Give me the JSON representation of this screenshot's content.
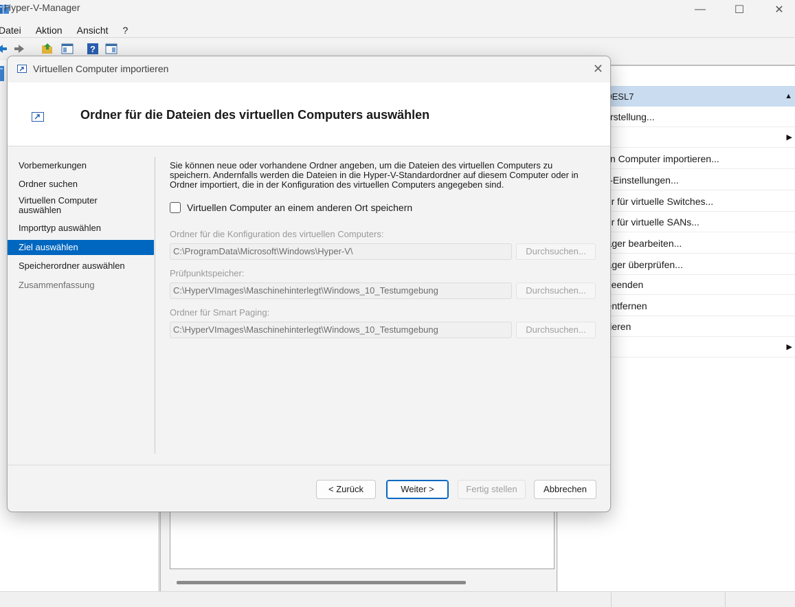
{
  "window": {
    "title": "Hyper-V-Manager",
    "minimize_glyph": "—",
    "maximize_glyph": "☐",
    "close_glyph": "✕"
  },
  "menu": [
    "Datei",
    "Aktion",
    "Ansicht",
    "?"
  ],
  "actions_pane": {
    "header": "N0ESL7",
    "items": [
      {
        "label": "llerstellung...",
        "arrow": false
      },
      {
        "label": "",
        "arrow": true
      },
      {
        "label": "llen Computer importieren...",
        "arrow": false
      },
      {
        "label": "-V-Einstellungen...",
        "arrow": false
      },
      {
        "label": "ger für virtuelle Switches...",
        "arrow": false
      },
      {
        "label": "ger für virtuelle SANs...",
        "arrow": false
      },
      {
        "label": "träger bearbeiten...",
        "arrow": false
      },
      {
        "label": "träger überprüfen...",
        "arrow": false
      },
      {
        "label": "t beenden",
        "arrow": false
      },
      {
        "label": "r entfernen",
        "arrow": false
      },
      {
        "label": "lisieren",
        "arrow": false
      },
      {
        "label": "nt",
        "arrow": true
      }
    ]
  },
  "dialog": {
    "title": "Virtuellen Computer importieren",
    "close_glyph": "✕",
    "heading": "Ordner für die Dateien des virtuellen Computers auswählen",
    "nav": [
      {
        "label": "Vorbemerkungen",
        "state": "normal"
      },
      {
        "label": "Ordner suchen",
        "state": "normal"
      },
      {
        "label": "Virtuellen Computer auswählen",
        "state": "normal"
      },
      {
        "label": "Importtyp auswählen",
        "state": "normal"
      },
      {
        "label": "Ziel auswählen",
        "state": "active"
      },
      {
        "label": "Speicherordner auswählen",
        "state": "normal"
      },
      {
        "label": "Zusammenfassung",
        "state": "disabled"
      }
    ],
    "description": "Sie können neue oder vorhandene Ordner angeben, um die Dateien des virtuellen Computers zu speichern. Andernfalls werden die Dateien in die Hyper-V-Standardordner auf diesem Computer oder in Ordner importiert, die in der Konfiguration des virtuellen Computers angegeben sind.",
    "checkbox": {
      "label": "Virtuellen Computer an einem anderen Ort speichern",
      "checked": false
    },
    "fields": [
      {
        "label": "Ordner für die Konfiguration des virtuellen Computers:",
        "value": "C:\\ProgramData\\Microsoft\\Windows\\Hyper-V\\",
        "browse": "Durchsuchen..."
      },
      {
        "label": "Prüfpunktspeicher:",
        "value": "C:\\HyperVImages\\Maschinehinterlegt\\Windows_10_Testumgebung",
        "browse": "Durchsuchen..."
      },
      {
        "label": "Ordner für Smart Paging:",
        "value": "C:\\HyperVImages\\Maschinehinterlegt\\Windows_10_Testumgebung",
        "browse": "Durchsuchen..."
      }
    ],
    "buttons": {
      "back": "< Zurück",
      "next": "Weiter >",
      "finish": "Fertig stellen",
      "cancel": "Abbrechen"
    }
  },
  "colors": {
    "accent": "#0067c0",
    "actions_header": "#c9dcf0"
  }
}
